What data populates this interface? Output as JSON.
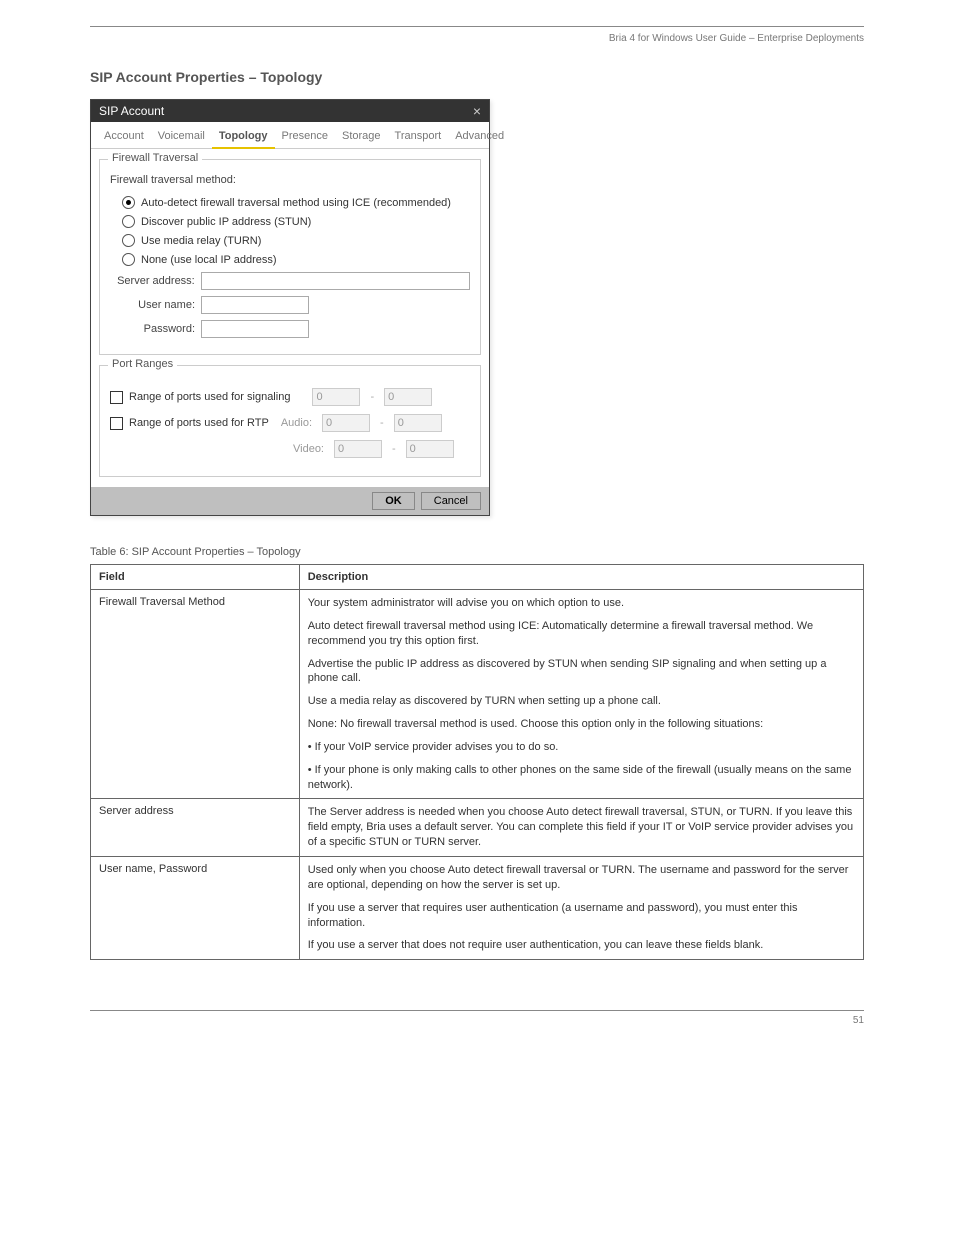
{
  "header": {
    "right": "Bria 4 for Windows User Guide – Enterprise Deployments"
  },
  "section_title": "SIP Account Properties – Topology",
  "dialog": {
    "title": "SIP Account",
    "tabs": [
      "Account",
      "Voicemail",
      "Topology",
      "Presence",
      "Storage",
      "Transport",
      "Advanced"
    ],
    "active_tab": 2,
    "firewall": {
      "legend": "Firewall Traversal",
      "method_label": "Firewall traversal method:",
      "radios": [
        "Auto-detect firewall traversal method using ICE (recommended)",
        "Discover public IP address (STUN)",
        "Use media relay (TURN)",
        "None (use local IP address)"
      ],
      "selected_radio": 0,
      "server_label": "Server address:",
      "user_label": "User name:",
      "pass_label": "Password:",
      "server_value": "",
      "user_value": "",
      "pass_value": ""
    },
    "ports": {
      "legend": "Port Ranges",
      "signaling_label": "Range of ports used for signaling",
      "rtp_label": "Range of ports used for RTP",
      "audio_label": "Audio:",
      "video_label": "Video:",
      "sig_lo": "0",
      "sig_hi": "0",
      "aud_lo": "0",
      "aud_hi": "0",
      "vid_lo": "0",
      "vid_hi": "0"
    },
    "ok": "OK",
    "cancel": "Cancel"
  },
  "table": {
    "caption": "Table 6: SIP Account Properties – Topology",
    "headers": [
      "Field",
      "Description"
    ],
    "rows": [
      {
        "field": "Firewall Traversal Method",
        "paras": [
          "Your system administrator will advise you on which option to use.",
          "Auto detect firewall traversal method using ICE: Automatically determine a firewall traversal method. We recommend you try this option first.",
          "Advertise the public IP address as discovered by STUN when sending SIP signaling and when setting up a phone call.",
          "Use a media relay as discovered by TURN when setting up a phone call.",
          "None: No firewall traversal method is used. Choose this option only in the following situations:",
          "• If your VoIP service provider advises you to do so.",
          "• If your phone is only making calls to other phones on the same side of the firewall (usually means on the same network)."
        ]
      },
      {
        "field": "Server address",
        "paras": [
          "The Server address is needed when you choose Auto detect firewall traversal, STUN, or TURN. If you leave this field empty, Bria uses a default server. You can complete this field if your IT or VoIP service provider advises you of a specific STUN or TURN server."
        ]
      },
      {
        "field": "User name, Password",
        "paras": [
          "Used only when you choose Auto detect firewall traversal or TURN. The username and password for the server are optional, depending on how the server is set up.",
          "If you use a server that requires user authentication (a username and password), you must enter this information.",
          "If you use a server that does not require user authentication, you can leave these fields blank."
        ]
      }
    ]
  },
  "footer": {
    "left": "",
    "right": "51"
  }
}
